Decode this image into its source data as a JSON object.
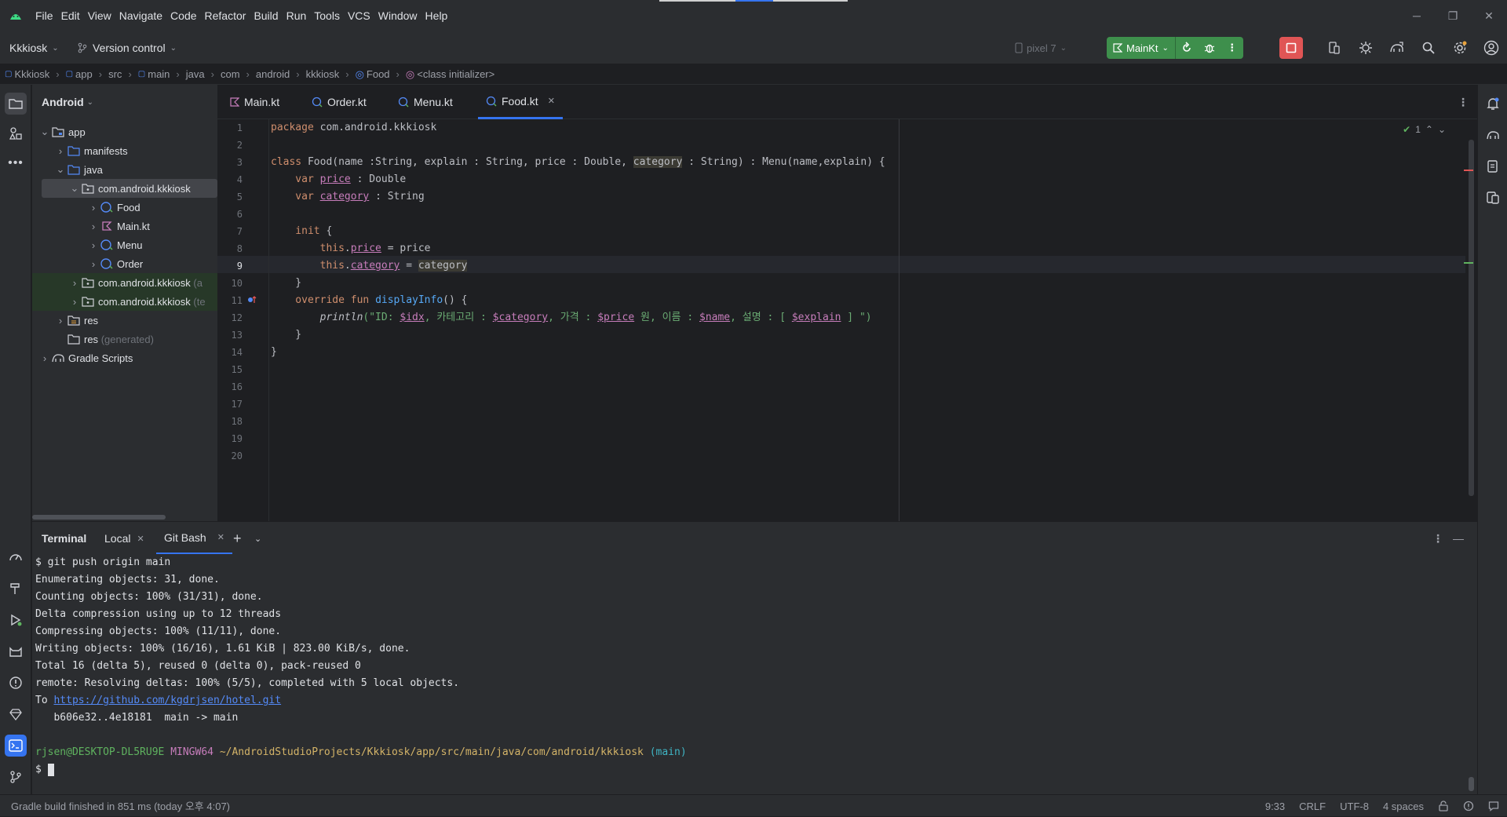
{
  "menu": [
    "File",
    "Edit",
    "View",
    "Navigate",
    "Code",
    "Refactor",
    "Build",
    "Run",
    "Tools",
    "VCS",
    "Window",
    "Help"
  ],
  "toolbar": {
    "project": "Kkkiosk",
    "vcs": "Version control",
    "device": "pixel 7",
    "run_config": "MainKt"
  },
  "breadcrumb": [
    "Kkkiosk",
    "app",
    "src",
    "main",
    "java",
    "com",
    "android",
    "kkkiosk",
    "Food",
    "<class initializer>"
  ],
  "project_panel": {
    "title": "Android",
    "tree": [
      {
        "label": "app",
        "level": 0
      },
      {
        "label": "manifests",
        "level": 1
      },
      {
        "label": "java",
        "level": 1
      },
      {
        "label": "com.android.kkkiosk",
        "level": 2
      },
      {
        "label": "Food",
        "level": 3
      },
      {
        "label": "Main.kt",
        "level": 3
      },
      {
        "label": "Menu",
        "level": 3
      },
      {
        "label": "Order",
        "level": 3
      },
      {
        "label": "com.android.kkkiosk",
        "suffix": "(a",
        "level": 2
      },
      {
        "label": "com.android.kkkiosk",
        "suffix": "(te",
        "level": 2
      },
      {
        "label": "res",
        "level": 1
      },
      {
        "label": "res",
        "suffix": "(generated)",
        "level": 1
      },
      {
        "label": "Gradle Scripts",
        "level": 0
      }
    ]
  },
  "editor_tabs": [
    "Main.kt",
    "Order.kt",
    "Menu.kt",
    "Food.kt"
  ],
  "editor": {
    "line_numbers": [
      "1",
      "2",
      "3",
      "4",
      "5",
      "6",
      "7",
      "8",
      "9",
      "10",
      "11",
      "12",
      "13",
      "14",
      "15",
      "16",
      "17",
      "18",
      "19",
      "20"
    ],
    "current_line": 9,
    "inspection_count": "1",
    "code": {
      "l1_kw": "package",
      "l1_rest": " com.android.kkkiosk",
      "l3_kw": "class",
      "l3_a": " Food(name :String, explain : String, price : Double, ",
      "l3_hl": "category",
      "l3_b": " : String) : Menu(name,explain) {",
      "l4_kw": "    var",
      "l4_prop": "price",
      "l4_rest": " : Double",
      "l5_kw": "    var",
      "l5_prop": "category",
      "l5_rest": " : String",
      "l7_kw": "    init",
      "l7_rest": " {",
      "l8_kw": "        this",
      "l8_prop": "price",
      "l8_rest": " = price",
      "l9_kw": "        this",
      "l9_prop": "category",
      "l9_eq": " = ",
      "l9_hl": "category",
      "l10": "    }",
      "l11_kw": "    override fun",
      "l11_fn": "displayInfo",
      "l11_rest": "() {",
      "l12_fn": "        println",
      "l12_s1": "(\"ID: ",
      "l12_v1": "$idx",
      "l12_s2": ", 카테고리 : ",
      "l12_v2": "$category",
      "l12_s3": ", 가격 : ",
      "l12_v3": "$price",
      "l12_s4": " 원, 이름 : ",
      "l12_v4": "$name",
      "l12_s5": ", 설명 : [ ",
      "l12_v5": "$explain",
      "l12_s6": " ] \")",
      "l13": "    }",
      "l14": "}"
    }
  },
  "terminal": {
    "title": "Terminal",
    "tabs": [
      "Local",
      "Git Bash"
    ],
    "lines": [
      "$ git push origin main",
      "Enumerating objects: 31, done.",
      "Counting objects: 100% (31/31), done.",
      "Delta compression using up to 12 threads",
      "Compressing objects: 100% (11/11), done.",
      "Writing objects: 100% (16/16), 1.61 KiB | 823.00 KiB/s, done.",
      "Total 16 (delta 5), reused 0 (delta 0), pack-reused 0",
      "remote: Resolving deltas: 100% (5/5), completed with 5 local objects."
    ],
    "to_prefix": "To ",
    "to_url": "https://github.com/kgdrjsen/hotel.git",
    "push_result": "   b606e32..4e18181  main -> main",
    "prompt_user": "rjsen@DESKTOP-DL5RU9E",
    "prompt_host": "MINGW64",
    "prompt_path": "~/AndroidStudioProjects/Kkkiosk/app/src/main/java/com/android/kkkiosk",
    "prompt_branch": "(main)",
    "prompt_symbol": "$ "
  },
  "statusbar": {
    "message": "Gradle build finished in 851 ms (today 오후 4:07)",
    "position": "9:33",
    "line_sep": "CRLF",
    "encoding": "UTF-8",
    "indent": "4 spaces"
  },
  "colors": {
    "accent": "#3574f0",
    "run_green": "#3e8f4c",
    "stop_red": "#e05555",
    "android_green": "#3ddc84"
  }
}
